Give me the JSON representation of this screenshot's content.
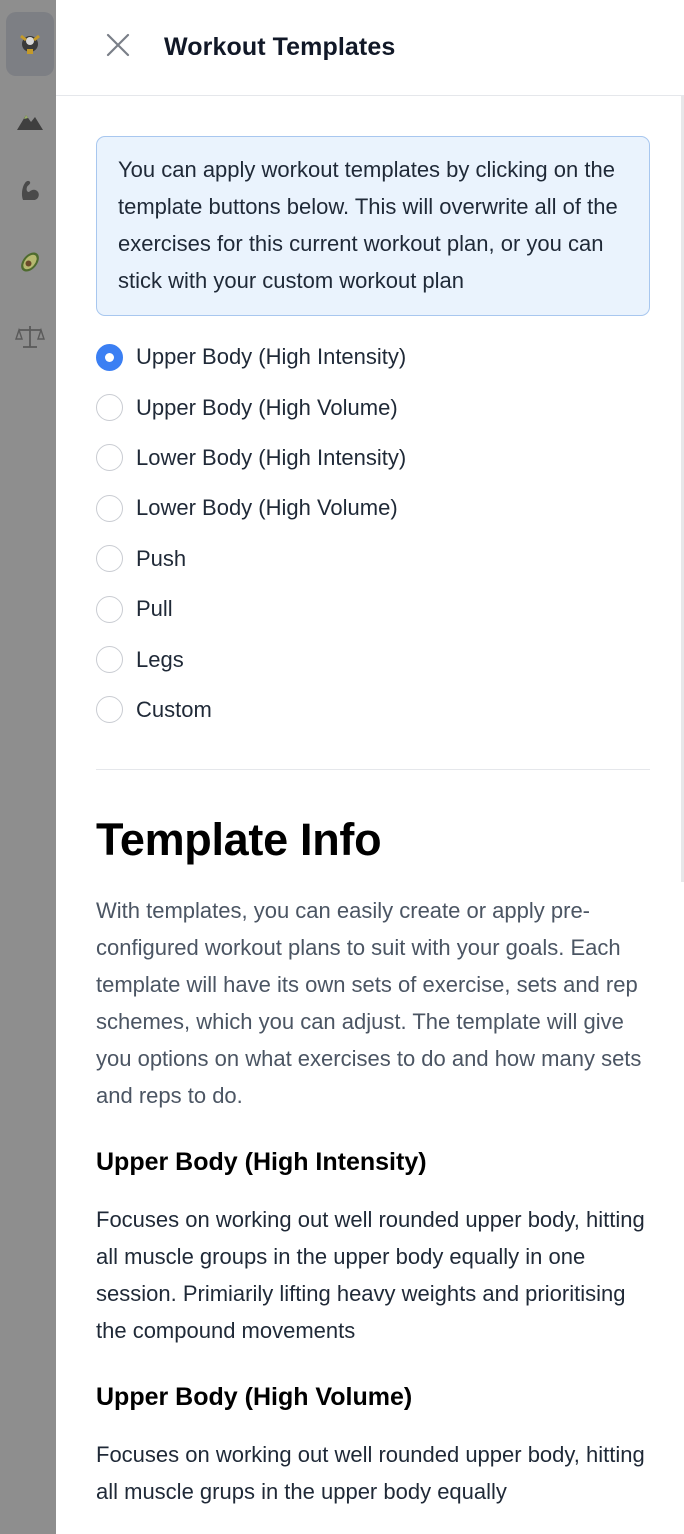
{
  "header": {
    "title": "Workout Templates",
    "close_icon": "close-icon"
  },
  "sidebar": {
    "items": [
      {
        "icon": "logo-icon",
        "active": true
      },
      {
        "icon": "mountain-icon",
        "active": false
      },
      {
        "icon": "muscle-icon",
        "active": false
      },
      {
        "icon": "avocado-icon",
        "active": false
      },
      {
        "icon": "scale-icon",
        "active": false
      }
    ]
  },
  "info_box": {
    "text": "You can apply workout templates by clicking on the template buttons below. This will overwrite all of the exercises for this current workout plan, or you can stick with your custom workout plan"
  },
  "templates": {
    "selected": "Upper Body (High Intensity)",
    "options": [
      {
        "label": "Upper Body (High Intensity)",
        "checked": true
      },
      {
        "label": "Upper Body (High Volume)",
        "checked": false
      },
      {
        "label": "Lower Body (High Intensity)",
        "checked": false
      },
      {
        "label": "Lower Body (High Volume)",
        "checked": false
      },
      {
        "label": "Push",
        "checked": false
      },
      {
        "label": "Pull",
        "checked": false
      },
      {
        "label": "Legs",
        "checked": false
      },
      {
        "label": "Custom",
        "checked": false
      }
    ]
  },
  "template_info": {
    "heading": "Template Info",
    "intro": "With templates, you can easily create or apply pre-configured workout plans to suit with your goals. Each template will have its own sets of exercise, sets and rep schemes, which you can adjust. The template will give you options on what exercises to do and how many sets and reps to do.",
    "sections": [
      {
        "title": "Upper Body (High Intensity)",
        "text": "Focuses on working out well rounded upper body, hitting all muscle groups in the upper body equally in one session. Primiarily lifting heavy weights and prioritising the compound movements"
      },
      {
        "title": "Upper Body (High Volume)",
        "text": "Focuses on working out well rounded upper body, hitting all muscle grups in the upper body equally"
      }
    ]
  },
  "colors": {
    "accent": "#3b7ff3",
    "info_bg": "#eaf3fd",
    "info_border": "#a8c7ef"
  }
}
